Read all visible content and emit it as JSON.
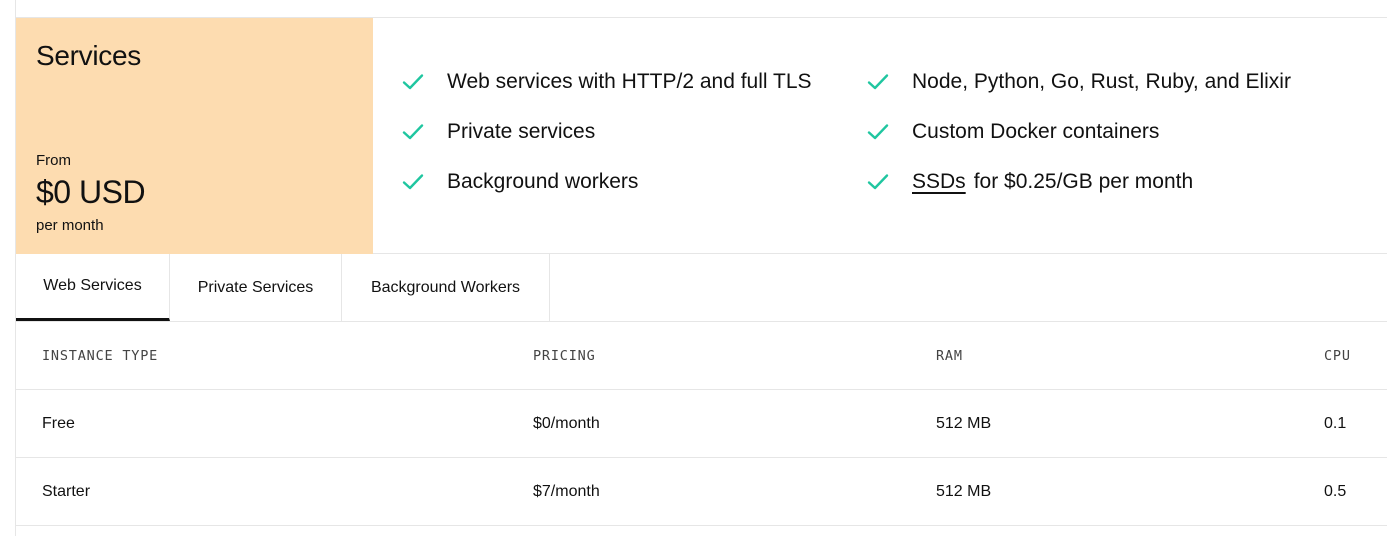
{
  "card": {
    "title": "Services",
    "price_prefix": "From",
    "price_amount": "$0 USD",
    "price_period": "per month",
    "background_color": "#fddcb0"
  },
  "features": {
    "check_color": "#1fc6a0",
    "left": [
      {
        "text": "Web services with HTTP/2 and full TLS"
      },
      {
        "text": "Private services"
      },
      {
        "text": "Background workers"
      }
    ],
    "right": [
      {
        "text": "Node, Python, Go, Rust, Ruby, and Elixir"
      },
      {
        "text": "Custom Docker containers"
      },
      {
        "link_text": "SSDs",
        "text": "for $0.25/GB per month"
      }
    ]
  },
  "tabs": [
    {
      "label": "Web Services",
      "active": true
    },
    {
      "label": "Private Services",
      "active": false
    },
    {
      "label": "Background Workers",
      "active": false
    }
  ],
  "table": {
    "headers": [
      "INSTANCE TYPE",
      "PRICING",
      "RAM",
      "CPU"
    ],
    "rows": [
      [
        "Free",
        "$0/month",
        "512 MB",
        "0.1"
      ],
      [
        "Starter",
        "$7/month",
        "512 MB",
        "0.5"
      ]
    ]
  }
}
